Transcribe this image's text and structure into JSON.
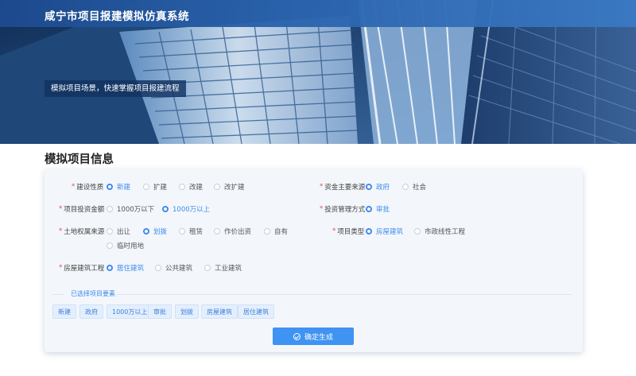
{
  "header": {
    "app_title": "咸宁市项目报建模拟仿真系统",
    "slogan": "模拟项目场景，快速掌握项目报建流程"
  },
  "section_title": "模拟项目信息",
  "form": {
    "construction_nature": {
      "label": "建设性质",
      "required": "*",
      "options": [
        "新建",
        "扩建",
        "改建",
        "改扩建"
      ],
      "selected": "新建"
    },
    "fund_source": {
      "label": "资金主要来源",
      "required": "*",
      "options": [
        "政府",
        "社会"
      ],
      "selected": "政府"
    },
    "investment_amount": {
      "label": "项目投资金额",
      "required": "*",
      "options": [
        "1000万以下",
        "1000万以上"
      ],
      "selected": "1000万以上"
    },
    "management_mode": {
      "label": "投资管理方式",
      "required": "*",
      "options": [
        "审批"
      ],
      "selected": "审批"
    },
    "land_source": {
      "label": "土地权属来源",
      "required": "*",
      "options": [
        "出让",
        "划拨",
        "租赁",
        "作价出资",
        "自有",
        "临时用地"
      ],
      "selected": "划拨"
    },
    "project_type": {
      "label": "项目类型",
      "required": "*",
      "options": [
        "房屋建筑",
        "市政线性工程"
      ],
      "selected": "房屋建筑"
    },
    "building_type": {
      "label": "房屋建筑工程",
      "required": "*",
      "options": [
        "居住建筑",
        "公共建筑",
        "工业建筑"
      ],
      "selected": "居住建筑"
    }
  },
  "selected_section": {
    "title": "已选择项目要素",
    "tags": [
      "新建",
      "政府",
      "1000万以上",
      "审批",
      "划拨",
      "房屋建筑",
      "居住建筑"
    ]
  },
  "confirm_button": {
    "label": "确定生成",
    "icon": "check-circle-icon"
  },
  "colors": {
    "accent": "#3e8bf0",
    "title_bar": "#2a63ad",
    "required": "#e34b4b",
    "card_bg": "#f3f7fb"
  }
}
